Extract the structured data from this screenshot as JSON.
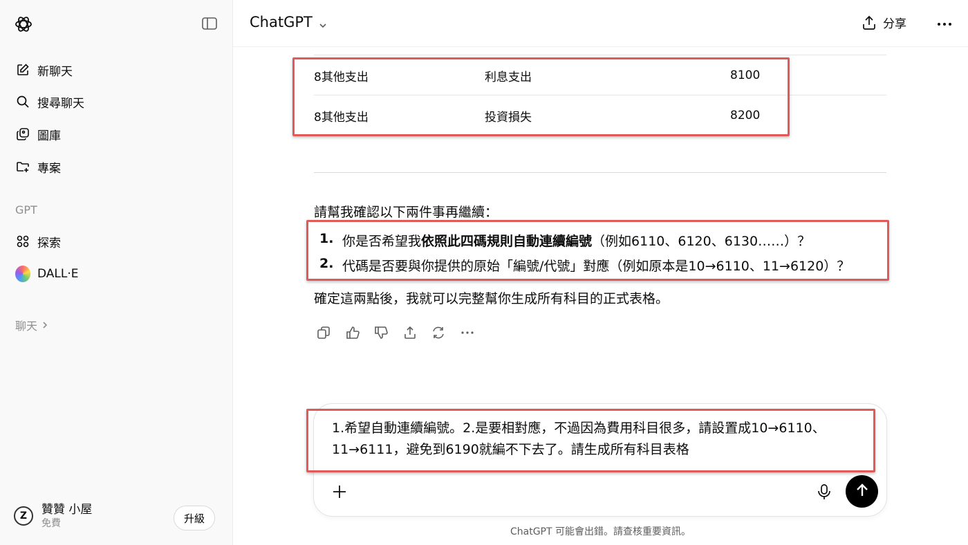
{
  "sidebar": {
    "items": [
      {
        "label": "新聊天",
        "icon": "edit-icon"
      },
      {
        "label": "搜尋聊天",
        "icon": "search-icon"
      },
      {
        "label": "圖庫",
        "icon": "gallery-icon"
      },
      {
        "label": "專案",
        "icon": "folder-add-icon"
      }
    ],
    "gpt_section": "GPT",
    "gpts": [
      {
        "label": "探索",
        "icon": "grid-icon"
      },
      {
        "label": "DALL·E",
        "icon": "dalle-icon"
      }
    ],
    "chats_section": "聊天",
    "user": {
      "name": "贊贊 小屋",
      "plan": "免費",
      "avatar_letter": "Z"
    },
    "upgrade_label": "升級"
  },
  "header": {
    "model": "ChatGPT",
    "share_label": "分享"
  },
  "table": {
    "rows": [
      {
        "category": "8其他支出",
        "item": "利息支出",
        "code": "8100"
      },
      {
        "category": "8其他支出",
        "item": "投資損失",
        "code": "8200"
      }
    ]
  },
  "message": {
    "intro": "請幫我確認以下兩件事再繼續：",
    "list": [
      {
        "num": "1.",
        "pre": "你是否希望我",
        "bold": "依照此四碼規則自動連續編號",
        "post": "（例如6110、6120、6130……）？"
      },
      {
        "num": "2.",
        "pre": "代碼是否要與你提供的原始「編號/代號」對應（例如原本是10→6110、11→6120）？",
        "bold": "",
        "post": ""
      }
    ],
    "outro": "確定這兩點後，我就可以完整幫你生成所有科目的正式表格。"
  },
  "composer": {
    "text_line1": "1.希望自動連續編號。2.是要相對應，不過因為費用科目很多，請設置成10→6110、",
    "text_line2": "11→6111，避免到6190就編不下去了。請生成所有科目表格"
  },
  "disclaimer": "ChatGPT 可能會出錯。請查核重要資訊。",
  "colors": {
    "highlight": "#e05a5a",
    "sidebar_bg": "#f9f9f9",
    "send_bg": "#000000"
  }
}
